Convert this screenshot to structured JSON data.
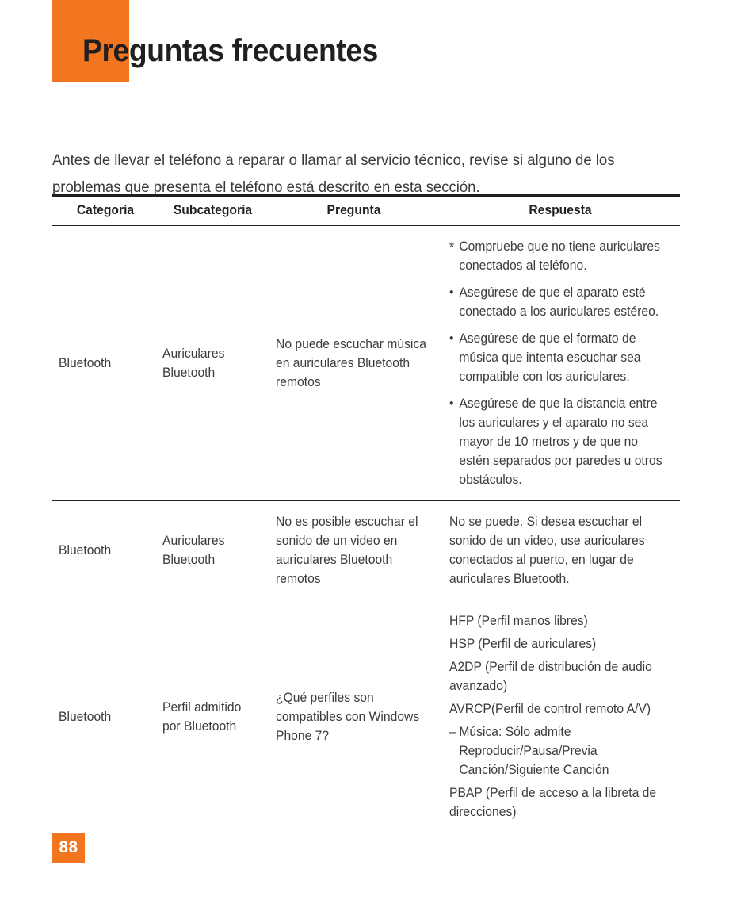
{
  "header": {
    "title": "Preguntas frecuentes",
    "accent_color": "#F1761F",
    "title_color": "#231F20"
  },
  "intro": {
    "text": "Antes de llevar el teléfono a reparar o llamar al servicio técnico, revise si alguno de los problemas que presenta el teléfono está descrito en esta sección."
  },
  "table": {
    "columns": [
      "Categoría",
      "Subcategoría",
      "Pregunta",
      "Respuesta"
    ],
    "rows": [
      {
        "category": "Bluetooth",
        "subcategory": "Auriculares Bluetooth",
        "question": "No puede escuchar música en auriculares Bluetooth remotos",
        "answer_type": "list",
        "answer_items": [
          {
            "marker": "*",
            "text": "Compruebe que no tiene auriculares conectados al teléfono."
          },
          {
            "marker": "•",
            "text": "Asegúrese de que el aparato esté conectado a los auriculares estéreo."
          },
          {
            "marker": "•",
            "text": "Asegúrese de que el formato de música que intenta escuchar sea compatible con los auriculares."
          },
          {
            "marker": "•",
            "text": "Asegúrese de que la distancia entre los auriculares y el aparato no sea mayor de 10 metros y de que no estén separados por paredes u otros obstáculos."
          }
        ]
      },
      {
        "category": "Bluetooth",
        "subcategory": "Auriculares Bluetooth",
        "question": "No es posible escuchar el sonido de un video en auriculares Bluetooth remotos",
        "answer_type": "paragraph",
        "answer_text": "No se puede. Si desea escuchar el sonido de un video, use auriculares conectados al puerto, en lugar de auriculares Bluetooth."
      },
      {
        "category": "Bluetooth",
        "subcategory": "Perfil admitido por Bluetooth",
        "question": "¿Qué perfiles son compatibles con Windows Phone 7?",
        "answer_type": "plain-list",
        "answer_items": [
          {
            "marker": "",
            "text": "HFP (Perfil manos libres)"
          },
          {
            "marker": "",
            "text": "HSP (Perfil de auriculares)"
          },
          {
            "marker": "",
            "text": "A2DP (Perfil de distribución de audio avanzado)"
          },
          {
            "marker": "",
            "text": "AVRCP(Perfil de control remoto A/V)"
          },
          {
            "marker": "–",
            "text": "Música: Sólo admite Reproducir/Pausa/Previa Canción/Siguiente Canción"
          },
          {
            "marker": "",
            "text": "PBAP (Perfil de acceso a la libreta de direcciones)"
          }
        ]
      }
    ]
  },
  "footer": {
    "page_number": "88",
    "badge_color": "#F1761F"
  }
}
